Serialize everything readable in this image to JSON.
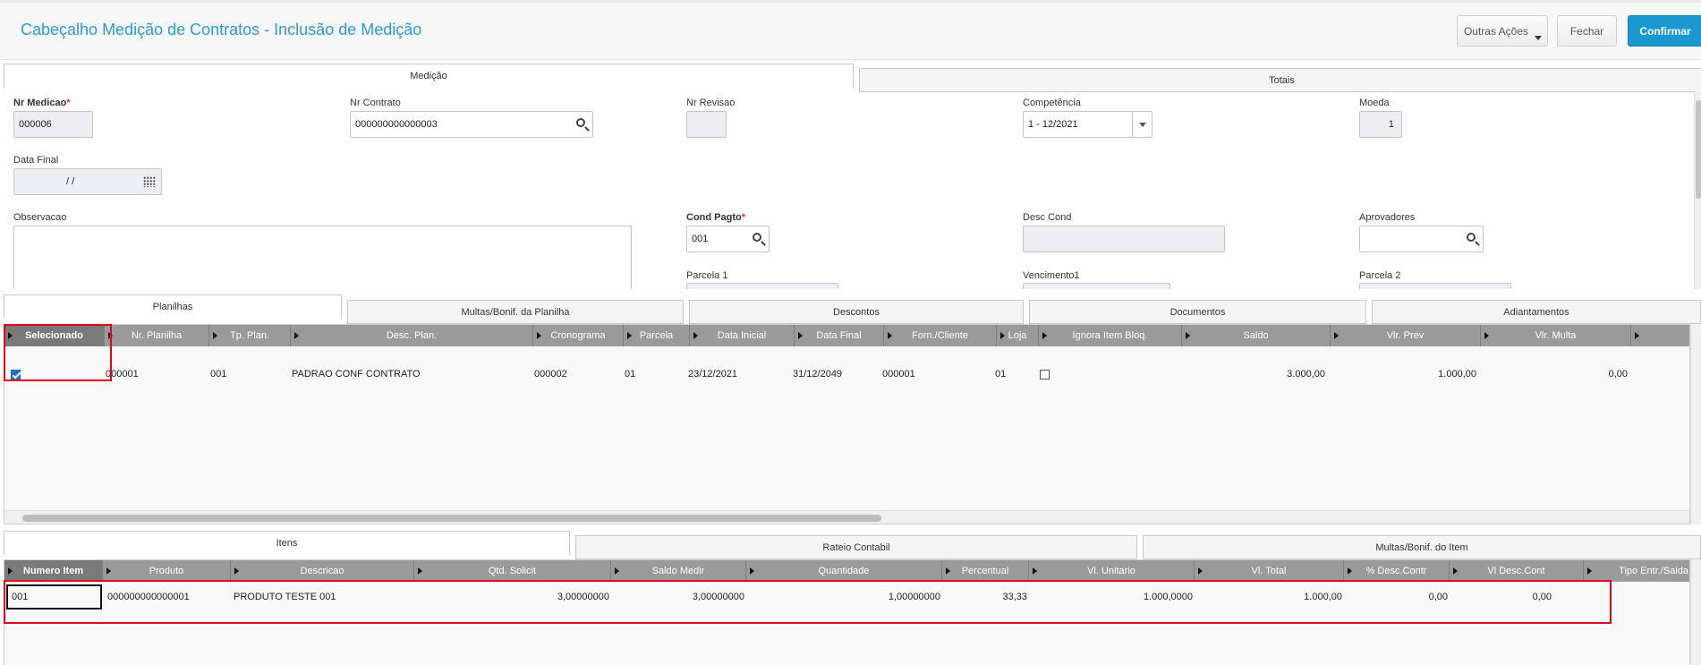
{
  "header": {
    "title": "Cabeçalho Medição de Contratos - Inclusão de Medição",
    "outras_acoes": "Outras Ações",
    "fechar": "Fechar",
    "confirmar": "Confirmar"
  },
  "top_tabs": [
    "Medição",
    "Totais"
  ],
  "form": {
    "nr_medicao_label": "Nr Medicao",
    "nr_medicao_value": "000006",
    "nr_contrato_label": "Nr Contrato",
    "nr_contrato_value": "000000000000003",
    "nr_revisao_label": "Nr Revisao",
    "nr_revisao_value": "",
    "competencia_label": "Competência",
    "competencia_value": "1 - 12/2021",
    "moeda_label": "Moeda",
    "moeda_value": "1",
    "data_final_label": "Data Final",
    "data_final_value": "/ /",
    "observacao_label": "Observacao",
    "observacao_value": "",
    "cond_pagto_label": "Cond Pagto",
    "cond_pagto_value": "001",
    "desc_cond_label": "Desc Cond",
    "desc_cond_value": "",
    "aprovadores_label": "Aprovadores",
    "aprovadores_value": "",
    "parcela1_label": "Parcela 1",
    "vencimento1_label": "Vencimento1",
    "parcela2_label": "Parcela 2",
    "required_mark": "*"
  },
  "mid_tabs": [
    "Planilhas",
    "Multas/Bonif. da Planilha",
    "Descontos",
    "Documentos",
    "Adiantamentos"
  ],
  "planilhas": {
    "columns": [
      "Selecionado",
      "Nr. Planilha",
      "Tp. Plan.",
      "Desc. Plan.",
      "Cronograma",
      "Parcela",
      "Data Inicial",
      "Data Final",
      "Forn./Cliente",
      "Loja",
      "Ignora Item Bloq.",
      "Saldo",
      "Vlr. Prev",
      "Vlr. Multa"
    ],
    "rows": [
      {
        "selecionado": true,
        "nr_planilha": "000001",
        "tp_plan": "001",
        "desc_plan": "PADRAO CONF CONTRATO",
        "cronograma": "000002",
        "parcela": "01",
        "data_inicial": "23/12/2021",
        "data_final": "31/12/2049",
        "forn_cliente": "000001",
        "loja": "01",
        "ignora": false,
        "saldo": "3.000,00",
        "vlr_prev": "1.000,00",
        "vlr_multa": "0,00"
      }
    ]
  },
  "bottom_tabs": [
    "Itens",
    "Rateio Contabil",
    "Multas/Bonif. do Item"
  ],
  "itens": {
    "columns": [
      "Numero Item",
      "Produto",
      "Descricao",
      "Qtd. Solicit",
      "Saldo Medir",
      "Quantidade",
      "Percentual",
      "Vl. Unitario",
      "Vl. Total",
      "% Desc.Contr",
      "Vl Desc.Cont",
      "Tipo Entr./Saida"
    ],
    "rows": [
      {
        "numero_item": "001",
        "produto": "000000000000001",
        "descricao": "PRODUTO TESTE 001",
        "qtd_solicit": "3,00000000",
        "saldo_medir": "3,00000000",
        "quantidade": "1,00000000",
        "percentual": "33,33",
        "vl_unitario": "1.000,0000",
        "vl_total": "1.000,00",
        "desc_contr": "0,00",
        "vl_desc_cont": "0,00"
      }
    ]
  },
  "colors": {
    "accent": "#1b98d0",
    "title": "#2b9bd3",
    "highlight": "#e3001b",
    "grid_header": "#9a9a9a"
  },
  "icons": [
    "search-icon",
    "calendar-icon",
    "dropdown-icon",
    "checkbox-icon"
  ]
}
